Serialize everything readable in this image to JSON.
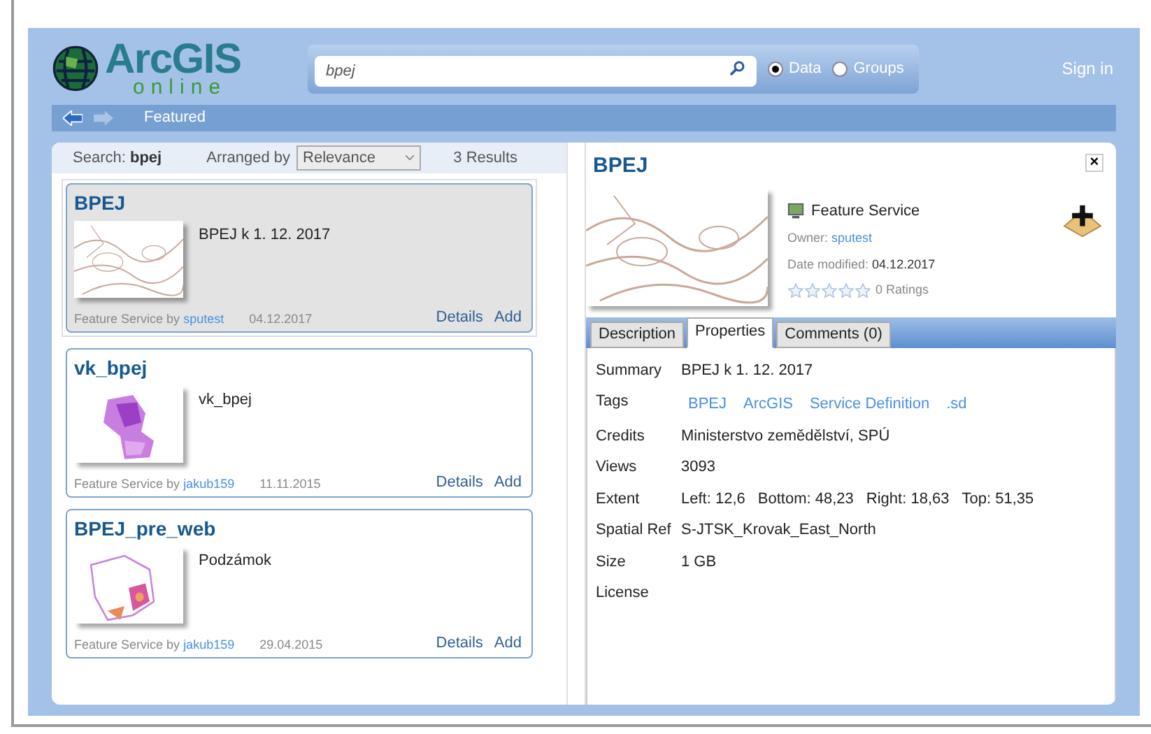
{
  "header": {
    "logo": {
      "name": "ArcGIS",
      "sub": "online"
    },
    "search": {
      "value": "bpej"
    },
    "scopes": [
      {
        "label": "Data",
        "selected": true
      },
      {
        "label": "Groups",
        "selected": false
      }
    ],
    "sign_in": "Sign in"
  },
  "nav": {
    "title": "Featured"
  },
  "results": {
    "search_label": "Search:",
    "query": "bpej",
    "arranged_label": "Arranged by",
    "sort": "Relevance",
    "count": "3 Results",
    "items": [
      {
        "title": "BPEJ",
        "summary": "BPEJ k 1. 12. 2017",
        "type": "Feature Service by",
        "owner": "sputest",
        "date": "04.12.2017",
        "details": "Details",
        "add": "Add",
        "selected": true
      },
      {
        "title": "vk_bpej",
        "summary": "vk_bpej",
        "type": "Feature Service by",
        "owner": "jakub159",
        "date": "11.11.2015",
        "details": "Details",
        "add": "Add",
        "selected": false
      },
      {
        "title": "BPEJ_pre_web",
        "summary": "Podzámok",
        "type": "Feature Service by",
        "owner": "jakub159",
        "date": "29.04.2015",
        "details": "Details",
        "add": "Add",
        "selected": false
      }
    ]
  },
  "detail": {
    "title": "BPEJ",
    "close": "×",
    "type": "Feature Service",
    "owner_label": "Owner:",
    "owner": "sputest",
    "modified_label": "Date modified:",
    "modified": "04.12.2017",
    "stars": 0,
    "ratings": "0 Ratings",
    "tabs": [
      {
        "label": "Description",
        "selected": false
      },
      {
        "label": "Properties",
        "selected": true
      },
      {
        "label": "Comments (0)",
        "selected": false
      }
    ],
    "properties": [
      {
        "kind": "text",
        "label": "Summary",
        "value": "BPEJ k 1. 12. 2017"
      },
      {
        "kind": "tags",
        "label": "Tags",
        "tags": [
          "BPEJ",
          "ArcGIS",
          "Service Definition",
          ".sd"
        ]
      },
      {
        "kind": "text",
        "label": "Credits",
        "value": "Ministerstvo zemědělství, SPÚ"
      },
      {
        "kind": "text",
        "label": "Views",
        "value": "3093"
      },
      {
        "kind": "extent",
        "label": "Extent",
        "parts": [
          {
            "label": "Left:",
            "value": "12,6"
          },
          {
            "label": "Bottom:",
            "value": "48,23"
          },
          {
            "label": "Right:",
            "value": "18,63"
          },
          {
            "label": "Top:",
            "value": "51,35"
          }
        ]
      },
      {
        "kind": "text",
        "label": "Spatial Ref",
        "value": "S-JTSK_Krovak_East_North"
      },
      {
        "kind": "text",
        "label": "Size",
        "value": "1 GB"
      },
      {
        "kind": "text",
        "label": "License"
      }
    ]
  }
}
